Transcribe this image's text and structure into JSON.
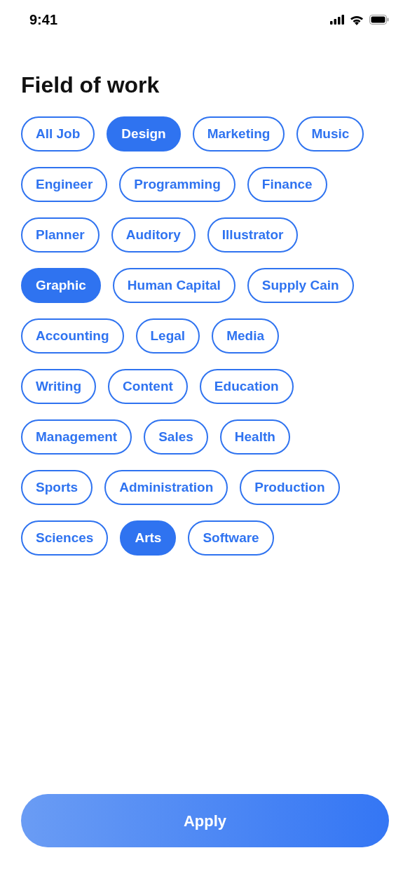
{
  "status_bar": {
    "time": "9:41"
  },
  "title": "Field of work",
  "chip_rows": [
    {
      "chips": [
        {
          "label": "All Job",
          "selected": false
        },
        {
          "label": "Design",
          "selected": true
        },
        {
          "label": "Marketing",
          "selected": false
        },
        {
          "label": "Music",
          "selected": false
        }
      ]
    },
    {
      "chips": [
        {
          "label": "Engineer",
          "selected": false
        },
        {
          "label": "Programming",
          "selected": false
        },
        {
          "label": "Finance",
          "selected": false
        }
      ]
    },
    {
      "chips": [
        {
          "label": "Planner",
          "selected": false
        },
        {
          "label": "Auditory",
          "selected": false
        },
        {
          "label": "Illustrator",
          "selected": false
        }
      ]
    },
    {
      "chips": [
        {
          "label": "Graphic",
          "selected": true
        },
        {
          "label": "Human Capital",
          "selected": false
        },
        {
          "label": "Supply Cain",
          "selected": false
        }
      ]
    },
    {
      "chips": [
        {
          "label": "Accounting",
          "selected": false
        },
        {
          "label": "Legal",
          "selected": false
        },
        {
          "label": "Media",
          "selected": false
        }
      ]
    },
    {
      "chips": [
        {
          "label": "Writing",
          "selected": false
        },
        {
          "label": "Content",
          "selected": false
        },
        {
          "label": "Education",
          "selected": false
        }
      ]
    },
    {
      "chips": [
        {
          "label": "Management",
          "selected": false
        },
        {
          "label": "Sales",
          "selected": false
        },
        {
          "label": "Health",
          "selected": false
        }
      ]
    },
    {
      "chips": [
        {
          "label": "Sports",
          "selected": false
        },
        {
          "label": "Administration",
          "selected": false
        },
        {
          "label": "Production",
          "selected": false
        }
      ]
    },
    {
      "chips": [
        {
          "label": "Sciences",
          "selected": false
        },
        {
          "label": "Arts",
          "selected": true
        },
        {
          "label": "Software",
          "selected": false
        }
      ]
    }
  ],
  "apply_button": {
    "label": "Apply"
  }
}
